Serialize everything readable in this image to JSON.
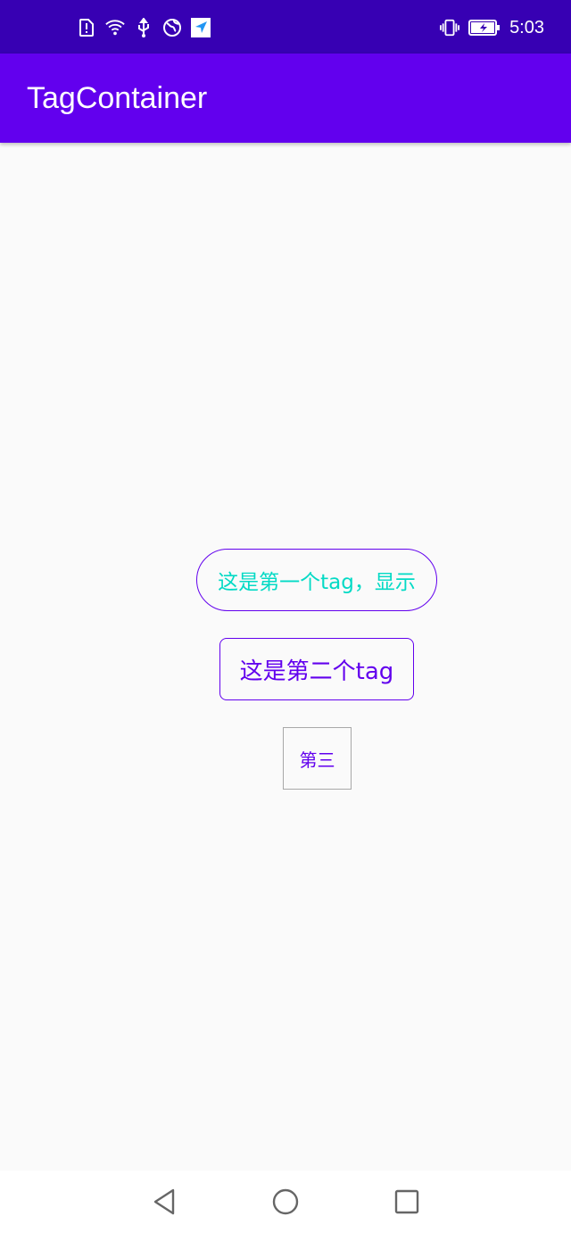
{
  "status_bar": {
    "time": "5:03",
    "left_icons": [
      "sim-alert-icon",
      "wifi-icon",
      "usb-icon",
      "vpn-globe-icon",
      "location-arrow-icon"
    ],
    "right_icons": [
      "vibrate-icon",
      "battery-charging-icon"
    ]
  },
  "app_bar": {
    "title": "TagContainer",
    "color": "#6200ee"
  },
  "tags": [
    {
      "label": "这是第一个tag，显示",
      "text_color": "#03dac5",
      "border_color": "#6200ee"
    },
    {
      "label": "这是第二个tag",
      "text_color": "#6200ee",
      "border_color": "#6200ee"
    },
    {
      "label": "第三",
      "text_color": "#6200ee",
      "border_color": "#a8a8a8"
    }
  ],
  "nav_bar": {
    "icons": [
      "back-icon",
      "home-icon",
      "recents-icon"
    ]
  }
}
